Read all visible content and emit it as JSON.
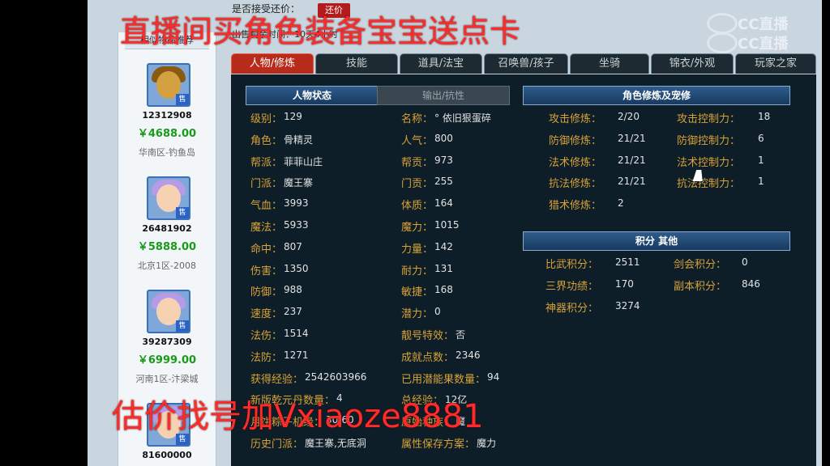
{
  "overlay": {
    "top_text": "直播间买角色装备宝宝送点卡",
    "bottom_text": "估价找号加Vxiaoze8881"
  },
  "watermark": {
    "line1": "CC直播",
    "line2": "CC直播"
  },
  "header": {
    "line1": "是否接受还价：",
    "counter_offer_button": "还价",
    "line2": "出售剩余时间：10天4小时"
  },
  "sidebar": {
    "title": "相似物品推荐",
    "items": [
      {
        "id": "12312908",
        "price": "￥4688.00",
        "server": "华南区-钓鱼岛",
        "tag": "售",
        "avatar": "gold"
      },
      {
        "id": "26481902",
        "price": "￥5888.00",
        "server": "北京1区-2008",
        "tag": "售",
        "avatar": "purple"
      },
      {
        "id": "39287309",
        "price": "￥6999.00",
        "server": "河南1区-汴梁城",
        "tag": "售",
        "avatar": "purple"
      },
      {
        "id": "81600000",
        "price": "",
        "server": "",
        "tag": "售",
        "avatar": "purple"
      }
    ]
  },
  "tabs": [
    "人物/修炼",
    "技能",
    "道具/法宝",
    "召唤兽/孩子",
    "坐骑",
    "锦衣/外观",
    "玩家之家"
  ],
  "active_tab": 0,
  "sections": {
    "status_tab": "人物状态",
    "output_tab": "输出/抗性",
    "cultivation": "角色修炼及宠修",
    "points": "积分 其他"
  },
  "character": {
    "left": [
      {
        "k": "级别：",
        "v": "129"
      },
      {
        "k": "角色：",
        "v": "骨精灵"
      },
      {
        "k": "帮派：",
        "v": "菲菲山庄"
      },
      {
        "k": "门派：",
        "v": "魔王寨"
      },
      {
        "k": "气血：",
        "v": "3993"
      },
      {
        "k": "魔法：",
        "v": "5933"
      },
      {
        "k": "命中：",
        "v": "807"
      },
      {
        "k": "伤害：",
        "v": "1350"
      },
      {
        "k": "防御：",
        "v": "988"
      },
      {
        "k": "速度：",
        "v": "237"
      },
      {
        "k": "法伤：",
        "v": "1514"
      },
      {
        "k": "法防：",
        "v": "1271"
      },
      {
        "k": "获得经验：",
        "v": "2542603966"
      },
      {
        "k": "新版乾元丹数量：",
        "v": "4"
      },
      {
        "k": "月饼粽子机缘：",
        "v": "30/60"
      },
      {
        "k": "历史门派：",
        "v": "魔王寨,无底洞"
      }
    ],
    "right": [
      {
        "k": "名称：",
        "v": "° 依旧狠蛋碎"
      },
      {
        "k": "人气：",
        "v": "800"
      },
      {
        "k": "帮贡：",
        "v": "973"
      },
      {
        "k": "门贡：",
        "v": "255"
      },
      {
        "k": "体质：",
        "v": "164"
      },
      {
        "k": "魔力：",
        "v": "1015"
      },
      {
        "k": "力量：",
        "v": "142"
      },
      {
        "k": "耐力：",
        "v": "131"
      },
      {
        "k": "敏捷：",
        "v": "168"
      },
      {
        "k": "潜力：",
        "v": "0"
      },
      {
        "k": "靓号特效：",
        "v": "否"
      },
      {
        "k": "成就点数：",
        "v": "2346"
      },
      {
        "k": "已用潜能果数量：",
        "v": "94"
      },
      {
        "k": "总经验：",
        "v": "12亿"
      },
      {
        "k": "原始种族：",
        "v": "魔"
      },
      {
        "k": "属性保存方案：",
        "v": "魔力"
      }
    ]
  },
  "cultivation": {
    "left": [
      {
        "k": "攻击修炼：",
        "v": "2/20"
      },
      {
        "k": "防御修炼：",
        "v": "21/21"
      },
      {
        "k": "法术修炼：",
        "v": "21/21"
      },
      {
        "k": "抗法修炼：",
        "v": "21/21"
      },
      {
        "k": "猎术修炼：",
        "v": "2"
      }
    ],
    "right": [
      {
        "k": "攻击控制力：",
        "v": "18"
      },
      {
        "k": "防御控制力：",
        "v": "6"
      },
      {
        "k": "法术控制力：",
        "v": "1"
      },
      {
        "k": "抗法控制力：",
        "v": "1"
      }
    ]
  },
  "points": {
    "left": [
      {
        "k": "比武积分：",
        "v": "2511"
      },
      {
        "k": "三界功绩：",
        "v": "170"
      },
      {
        "k": "神器积分：",
        "v": "3274"
      }
    ],
    "right": [
      {
        "k": "剑会积分：",
        "v": "0"
      },
      {
        "k": "副本积分：",
        "v": "846"
      }
    ]
  }
}
